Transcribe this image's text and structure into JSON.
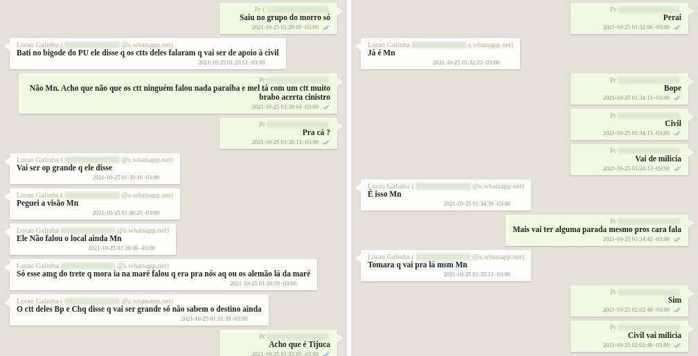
{
  "panels": [
    {
      "messages": [
        {
          "kind": "sent",
          "sender": "Pr (",
          "text": "Saiu no grupo do morro só",
          "time": "2021-10-25 01:29:09 -03:00"
        },
        {
          "kind": "received",
          "sender": "Lorao Galinha (",
          "sender_end": "@s.whatsapp.net)",
          "text": "Bati no bigode do PU ele disse q os ctts deles falaram q vai ser de apoio à civil",
          "time": "2021-10-25 01:29:51 -03:00"
        },
        {
          "kind": "sent",
          "sender": "Pr",
          "text": "Não Mn. Acho que não que os ctt ninguém falou nada paraiba e mel tá com um ctt muito brabo acerta cinistro",
          "time": "2021-10-25 01:30:04 -03:00"
        },
        {
          "kind": "sent",
          "sender": "Pr",
          "text": "Pra cá ?",
          "time": "2021-10-25 01:30:13 -03:00"
        },
        {
          "kind": "received",
          "sender": "Lorao Galinha (",
          "sender_end": "@s.whatsapp.net)",
          "text": "Vai ser op grande q ele disse",
          "time": "2021-10-25 01:30:16 -03:00"
        },
        {
          "kind": "received",
          "sender": "Lorao Galinha (",
          "sender_end": "@s.whatsapp.net)",
          "text": "Peguei a visão Mn",
          "time": "2021-10-25 01:30:25 -03:00"
        },
        {
          "kind": "received",
          "sender": "Lorao Galinha",
          "sender_end": "@s.whatsapp.net)",
          "text": "Ele Não falou o local ainda Mn",
          "time": "2021-10-25 01:30:36 -03:00"
        },
        {
          "kind": "received",
          "sender": "Lorao Galinha",
          "sender_end": "@s.whatsapp.net)",
          "text": "Só esse amg do trete q mora ia na maré falou q era pra nós aq ou os alemão lá da maré",
          "time": "2021-10-25 01:30:59 -03:00"
        },
        {
          "kind": "received",
          "sender": "Lorao Galinha (",
          "sender_end": "@s.whatsapp.net)",
          "text": "O ctt deles Bp e Chq disse q vai ser grande só não sabem o destino ainda",
          "time": "2021-10-25 01:31:39 -03:00"
        },
        {
          "kind": "sent",
          "sender": "Pr",
          "text": "Acho que é Tijuca",
          "time": "2021-10-25 01:32:05 -03:00"
        }
      ]
    },
    {
      "messages": [
        {
          "kind": "sent",
          "sender": "Pr",
          "text": "Perai",
          "time": "2021-10-25 01:32:06 -03:00"
        },
        {
          "kind": "received",
          "sender": "Lorao Galinha",
          "sender_end": "s.whatsapp.net)",
          "text": "Já é Mn",
          "time": "2021-10-25 01:32:23 -03:00"
        },
        {
          "kind": "sent",
          "sender": "Pr",
          "text": "Bope",
          "time": "2021-10-25 01:34:13 -03:00"
        },
        {
          "kind": "sent",
          "sender": "Pr",
          "text": "Civil",
          "time": "2021-10-25 01:34:13 -03:00"
        },
        {
          "kind": "sent",
          "sender": "Pr",
          "text": "Vai de milicia",
          "time": "2021-10-25 01:34:13 -03:00"
        },
        {
          "kind": "received",
          "sender": "Lorao Galinha (",
          "sender_end": "@s.whatsapp.net)",
          "text": "É isso Mn",
          "time": "2021-10-25 01:34:39 -03:00"
        },
        {
          "kind": "sent",
          "sender": "Pr",
          "text": "Mais vai ter alguma parada mesmo pros cara fala",
          "time": "2021-10-25 01:34:42 -03:00"
        },
        {
          "kind": "received",
          "sender": "Lorao Galinha (",
          "sender_end": "@s.whatsapp.net)",
          "text": "Tomara q vai pra lá msm Mn",
          "time": "2021-10-25 01:35:13 -03:00"
        },
        {
          "kind": "sent",
          "sender": "Pr",
          "text": "Sim",
          "time": "2021-10-25 02:02:46 -03:00"
        },
        {
          "kind": "sent",
          "sender": "Pr",
          "text": "Civil vai milicia",
          "time": "2021-10-25 02:02:46 -03:00"
        }
      ]
    }
  ]
}
